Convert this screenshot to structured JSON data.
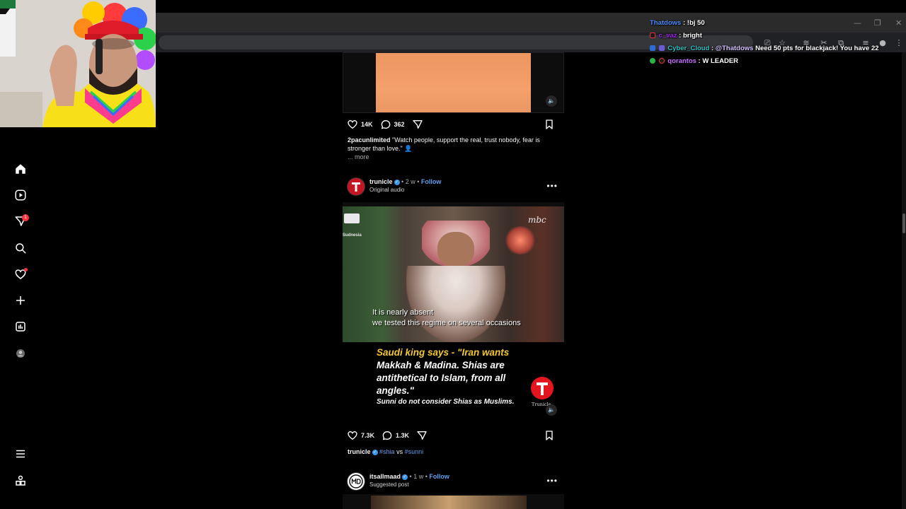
{
  "colors": {
    "accent_blue": "#5fa0f2",
    "verified_blue": "#3897f0",
    "notification_red": "#ff3040",
    "feed_background": "#000000"
  },
  "sidebar": {
    "items": [
      {
        "icon": "home-icon"
      },
      {
        "icon": "reels-icon"
      },
      {
        "icon": "messages-icon",
        "badge": "1"
      },
      {
        "icon": "search-icon"
      },
      {
        "icon": "notifications-icon"
      },
      {
        "icon": "create-icon"
      },
      {
        "icon": "dashboard-icon"
      },
      {
        "icon": "profile-avatar"
      }
    ],
    "bottom": [
      {
        "icon": "menu-icon"
      },
      {
        "icon": "more-apps-icon"
      }
    ]
  },
  "posts": [
    {
      "likes": "14K",
      "comments": "362",
      "caption_user": "2pacunlimited",
      "caption_text": "\"Watch people, support the real, trust nobody, fear is stronger than love.\"",
      "more_label": "... more"
    },
    {
      "username": "trunicle",
      "time": "2 w",
      "follow_label": "Follow",
      "subtitle": "Original audio",
      "video_subtitle_line1": "It is nearly absent",
      "video_subtitle_line2": "we tested this regime on several occasions",
      "video_headline_part1": "Saudi king says - \"Iran wants",
      "video_headline_part2": "Makkah & Madina. Shias are antithetical to Islam, from all angles.\"",
      "video_footer": "Sunni do not consider Shias as Muslims.",
      "watermark_top_right": "mbc",
      "watermark_top_left": "Sudnesia",
      "logo_caption": "Trunicle",
      "likes": "7.3K",
      "comments": "1.3K",
      "caption_user": "trunicle",
      "tag1": "#shia",
      "caption_mid": "vs",
      "tag2": "#sunni"
    },
    {
      "username": "itsallmaad",
      "time": "1 w",
      "follow_label": "Follow",
      "subtitle": "Suggested post"
    }
  ],
  "chat": [
    {
      "user": "Thatdows",
      "user_color": "#4a8cff",
      "message": "!bj 50"
    },
    {
      "user": "c_vaz",
      "user_color": "#a020f0",
      "message": "bright"
    },
    {
      "user": "Cyber_Cloud",
      "user_color": "#2ec4c4",
      "mention": "@Thatdows",
      "message": "Need 50 pts for blackjack! You have 22"
    },
    {
      "user": "qorantos",
      "user_color": "#c86bff",
      "message": "W LEADER"
    }
  ]
}
